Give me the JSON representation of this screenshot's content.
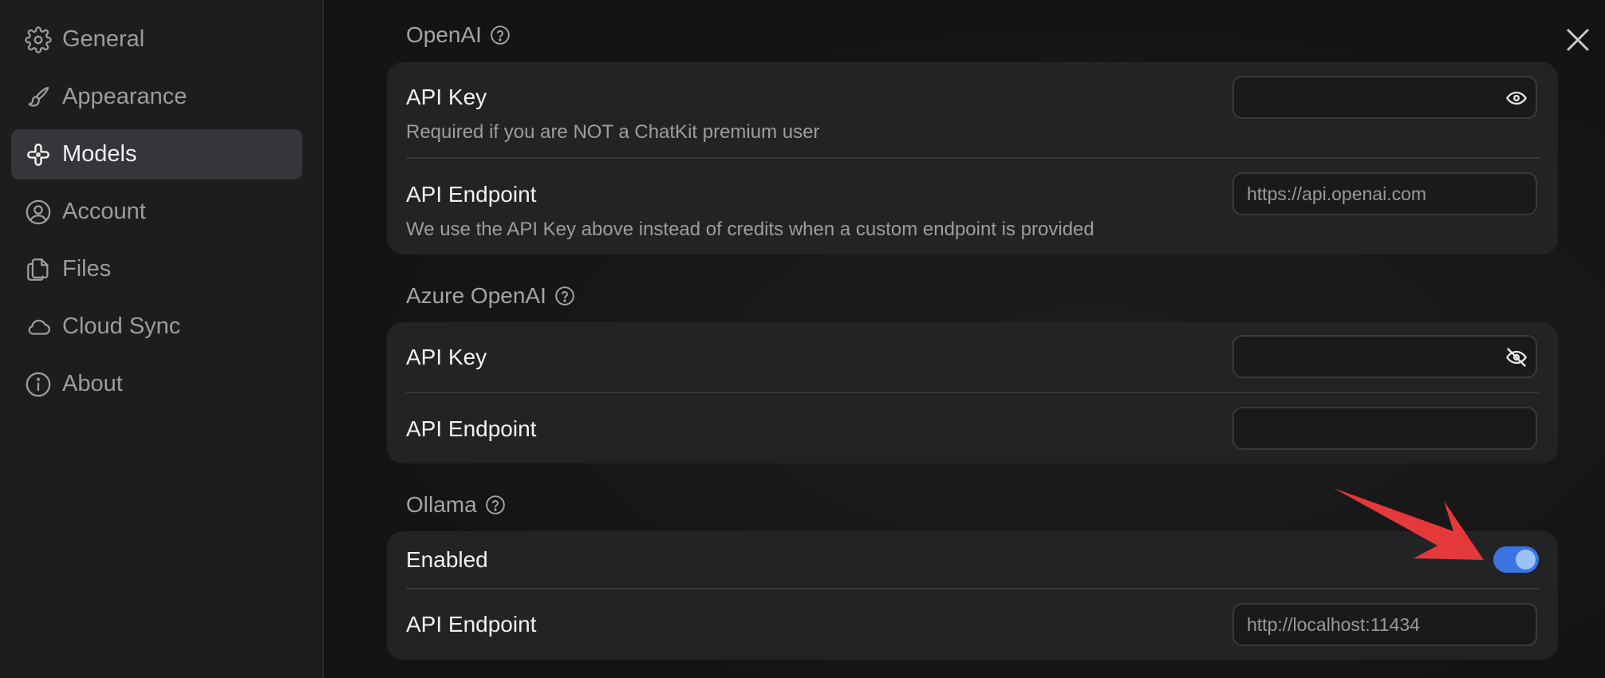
{
  "sidebar": {
    "items": [
      {
        "label": "General",
        "icon": "gear-icon",
        "active": false
      },
      {
        "label": "Appearance",
        "icon": "brush-icon",
        "active": false
      },
      {
        "label": "Models",
        "icon": "models-icon",
        "active": true
      },
      {
        "label": "Account",
        "icon": "user-circle-icon",
        "active": false
      },
      {
        "label": "Files",
        "icon": "files-icon",
        "active": false
      },
      {
        "label": "Cloud Sync",
        "icon": "cloud-icon",
        "active": false
      },
      {
        "label": "About",
        "icon": "info-icon",
        "active": false
      }
    ]
  },
  "sections": {
    "openai": {
      "title": "OpenAI",
      "api_key_label": "API Key",
      "api_key_desc": "Required if you are NOT a ChatKit premium user",
      "api_key_value": "",
      "endpoint_label": "API Endpoint",
      "endpoint_desc": "We use the API Key above instead of credits when a custom endpoint is provided",
      "endpoint_placeholder": "https://api.openai.com"
    },
    "azure": {
      "title": "Azure OpenAI",
      "api_key_label": "API Key",
      "api_key_value": "",
      "endpoint_label": "API Endpoint",
      "endpoint_value": ""
    },
    "ollama": {
      "title": "Ollama",
      "enabled_label": "Enabled",
      "enabled": true,
      "endpoint_label": "API Endpoint",
      "endpoint_placeholder": "http://localhost:11434"
    }
  },
  "colors": {
    "toggle_on": "#3b74e0",
    "annotation_arrow": "#e5383b"
  }
}
